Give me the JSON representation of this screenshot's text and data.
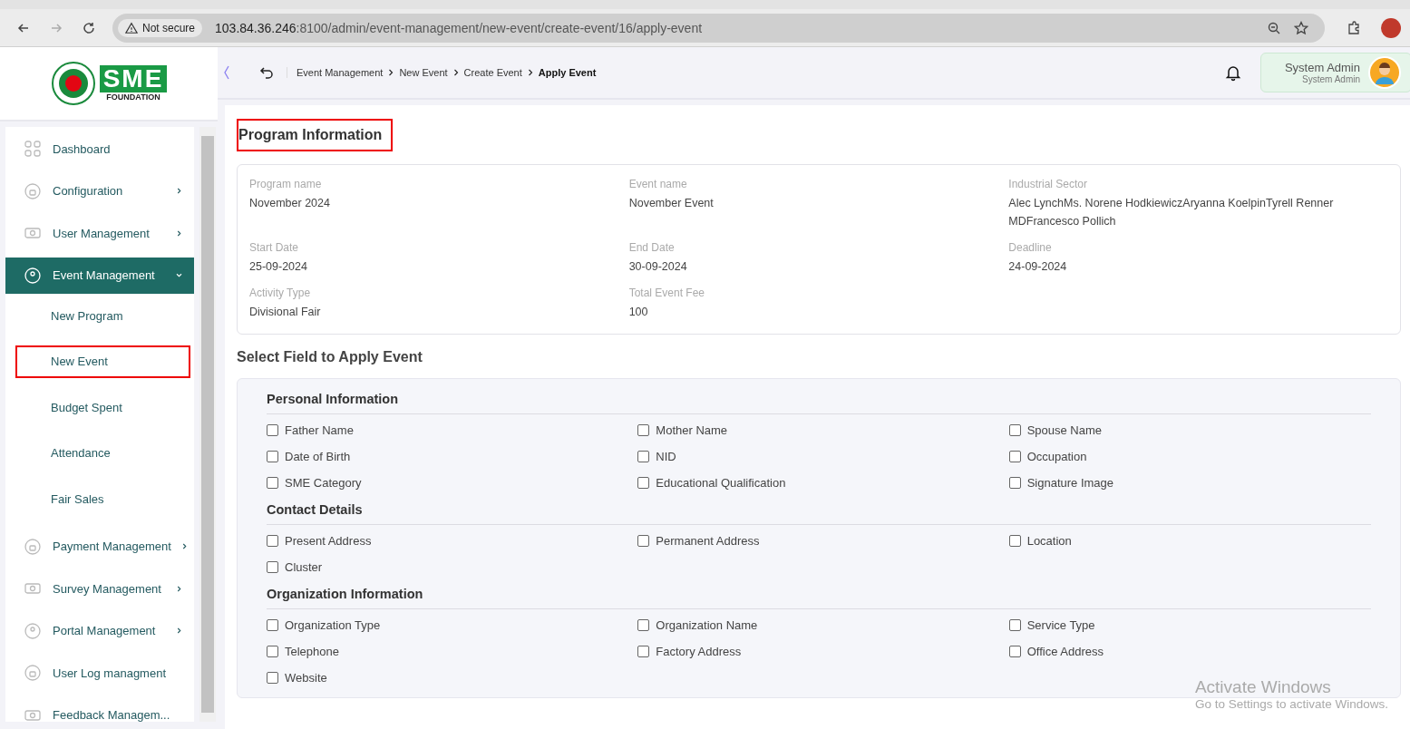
{
  "browser": {
    "security": "Not secure",
    "url_host": "103.84.36.246",
    "url_rest": ":8100/admin/event-management/new-event/create-event/16/apply-event"
  },
  "logo": {
    "text": "SME",
    "subtitle": "FOUNDATION"
  },
  "breadcrumb": [
    {
      "label": "Event Management",
      "current": false
    },
    {
      "label": "New Event",
      "current": false
    },
    {
      "label": "Create Event",
      "current": false
    },
    {
      "label": "Apply Event",
      "current": true
    }
  ],
  "user": {
    "name": "System Admin",
    "role": "System Admin"
  },
  "sidebar": {
    "items": [
      {
        "label": "Dashboard",
        "has_submenu": false,
        "selected": false
      },
      {
        "label": "Configuration",
        "has_submenu": true,
        "expanded": false,
        "selected": false
      },
      {
        "label": "User Management",
        "has_submenu": true,
        "expanded": false,
        "selected": false
      },
      {
        "label": "Event Management",
        "has_submenu": true,
        "expanded": true,
        "selected": true,
        "children": [
          {
            "label": "New Program",
            "highlighted": false
          },
          {
            "label": "New Event",
            "highlighted": true
          },
          {
            "label": "Budget Spent",
            "highlighted": false
          },
          {
            "label": "Attendance",
            "highlighted": false
          },
          {
            "label": "Fair Sales",
            "highlighted": false
          }
        ]
      },
      {
        "label": "Payment Management",
        "has_submenu": true,
        "expanded": false,
        "selected": false
      },
      {
        "label": "Survey Management",
        "has_submenu": true,
        "expanded": false,
        "selected": false
      },
      {
        "label": "Portal Management",
        "has_submenu": true,
        "expanded": false,
        "selected": false
      },
      {
        "label": "User Log managment",
        "has_submenu": false,
        "selected": false
      },
      {
        "label": "Feedback Managem...",
        "has_submenu": false,
        "selected": false
      }
    ]
  },
  "program_info": {
    "title": "Program Information",
    "highlighted": true,
    "fields": [
      {
        "label": "Program name",
        "value": "November 2024"
      },
      {
        "label": "Event name",
        "value": "November Event"
      },
      {
        "label": "Industrial Sector",
        "value": "Alec LynchMs. Norene HodkiewiczAryanna KoelpinTyrell Renner MDFrancesco Pollich"
      },
      {
        "label": "Start Date",
        "value": "25-09-2024"
      },
      {
        "label": "End Date",
        "value": "30-09-2024"
      },
      {
        "label": "Deadline",
        "value": "24-09-2024"
      },
      {
        "label": "Activity Type",
        "value": "Divisional Fair"
      },
      {
        "label": "Total Event Fee",
        "value": "100"
      }
    ]
  },
  "apply_section": {
    "title": "Select Field to Apply Event",
    "groups": [
      {
        "title": "Personal Information",
        "fields": [
          {
            "label": "Father Name",
            "checked": false
          },
          {
            "label": "Mother Name",
            "checked": false
          },
          {
            "label": "Spouse Name",
            "checked": false
          },
          {
            "label": "Date of Birth",
            "checked": false
          },
          {
            "label": "NID",
            "checked": false
          },
          {
            "label": "Occupation",
            "checked": false
          },
          {
            "label": "SME Category",
            "checked": false
          },
          {
            "label": "Educational Qualification",
            "checked": false
          },
          {
            "label": "Signature Image",
            "checked": false
          }
        ]
      },
      {
        "title": "Contact Details",
        "fields": [
          {
            "label": "Present Address",
            "checked": false
          },
          {
            "label": "Permanent Address",
            "checked": false
          },
          {
            "label": "Location",
            "checked": false
          },
          {
            "label": "Cluster",
            "checked": false
          }
        ]
      },
      {
        "title": "Organization Information",
        "fields": [
          {
            "label": "Organization Type",
            "checked": false
          },
          {
            "label": "Organization Name",
            "checked": false
          },
          {
            "label": "Service Type",
            "checked": false
          },
          {
            "label": "Telephone",
            "checked": false
          },
          {
            "label": "Factory Address",
            "checked": false
          },
          {
            "label": "Office Address",
            "checked": false
          },
          {
            "label": "Website",
            "checked": false
          }
        ]
      }
    ]
  },
  "os_notice": {
    "title": "Activate Windows",
    "text": "Go to Settings to activate Windows."
  }
}
